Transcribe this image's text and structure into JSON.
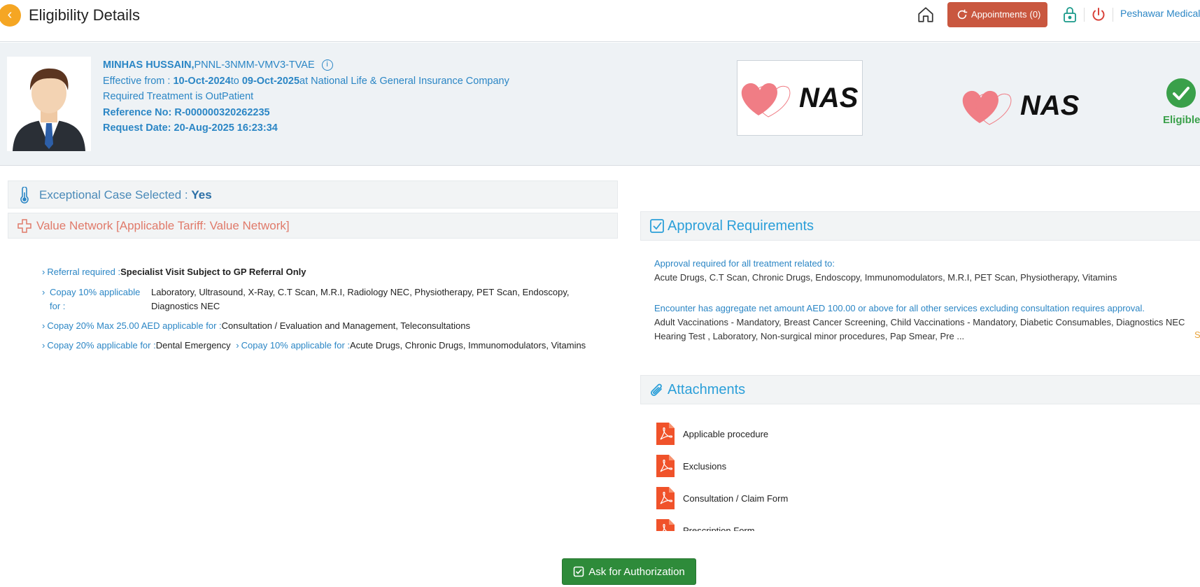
{
  "header": {
    "back_icon": "chevron-left-icon",
    "title": "Eligibility Details",
    "appointments_label": "Appointments",
    "appointments_count": "(0)",
    "facility": "Peshawar Medical C"
  },
  "patient": {
    "name": "MINHAS HUSSAIN,",
    "member_id": "PNNL-3NMM-VMV3-TVAE",
    "effective_prefix": "Effective from : ",
    "effective_from": "10-Oct-2024",
    "effective_to_prefix": "to ",
    "effective_to": "09-Oct-2025",
    "insurer_prefix": "at ",
    "insurer": "National Life & General Insurance Company",
    "treatment": "Required Treatment is OutPatient",
    "reference_label": "Reference No: ",
    "reference_no": "R-000000320262235",
    "request_date_label": "Request Date: ",
    "request_date": "20-Aug-2025 16:23:34",
    "logo_text": "NAS",
    "status": "Eligible"
  },
  "exception": {
    "label": "Exceptional Case Selected : ",
    "value": "Yes"
  },
  "network": {
    "label": "Value Network [Applicable Tariff: Value Network]"
  },
  "benefits": {
    "referral_label": "Referral required :",
    "referral_value": "Specialist Visit Subject to GP Referral Only",
    "copay1_label_a": "Copay 10% applicable",
    "copay1_label_b": "for :",
    "copay1_value_a": "Laboratory, Ultrasound, X-Ray, C.T Scan, M.R.I, Radiology NEC, Physiotherapy, PET Scan, Endoscopy,",
    "copay1_value_b": "Diagnostics NEC",
    "copay2_label": "Copay 20% Max 25.00 AED applicable for :",
    "copay2_value": "Consultation / Evaluation and Management, Teleconsultations",
    "copay3_label": "Copay 20% applicable for :",
    "copay3_value": "Dental Emergency",
    "copay4_label": "Copay 10% applicable for :",
    "copay4_value": "Acute Drugs, Chronic Drugs, Immunomodulators, Vitamins"
  },
  "approval": {
    "title": "Approval Requirements",
    "line1_label": "Approval required for all treatment related to:",
    "line1_value": "Acute Drugs, C.T Scan, Chronic Drugs, Endoscopy, Immunomodulators, M.R.I, PET Scan, Physiotherapy, Vitamins",
    "line2_label": "Encounter has aggregate net amount AED 100.00 or above for all other services excluding consultation requires approval.",
    "line2_value_a": "Adult Vaccinations - Mandatory, Breast Cancer Screening, Child Vaccinations - Mandatory, Diabetic Consumables, Diagnostics NEC",
    "line2_value_b": "Hearing Test , Laboratory, Non-surgical minor procedures, Pap Smear, Pre ...",
    "see_more": "S"
  },
  "attachments": {
    "title": "Attachments",
    "items": [
      {
        "label": "Applicable procedure",
        "icon": "pdf-icon"
      },
      {
        "label": "Exclusions",
        "icon": "pdf-icon"
      },
      {
        "label": "Consultation / Claim Form",
        "icon": "pdf-icon"
      },
      {
        "label": "Prescription Form",
        "icon": "pdf-icon"
      }
    ]
  },
  "actions": {
    "ask_authorization": "Ask for Authorization"
  },
  "colors": {
    "primary_blue": "#2b86c5",
    "appointments_bg": "#c9573f",
    "eligible_green": "#3aa04a",
    "authorize_green": "#2e8b3a",
    "back_orange": "#f5a623",
    "network_salmon": "#e07a6a",
    "pdf_red": "#f0522a"
  }
}
